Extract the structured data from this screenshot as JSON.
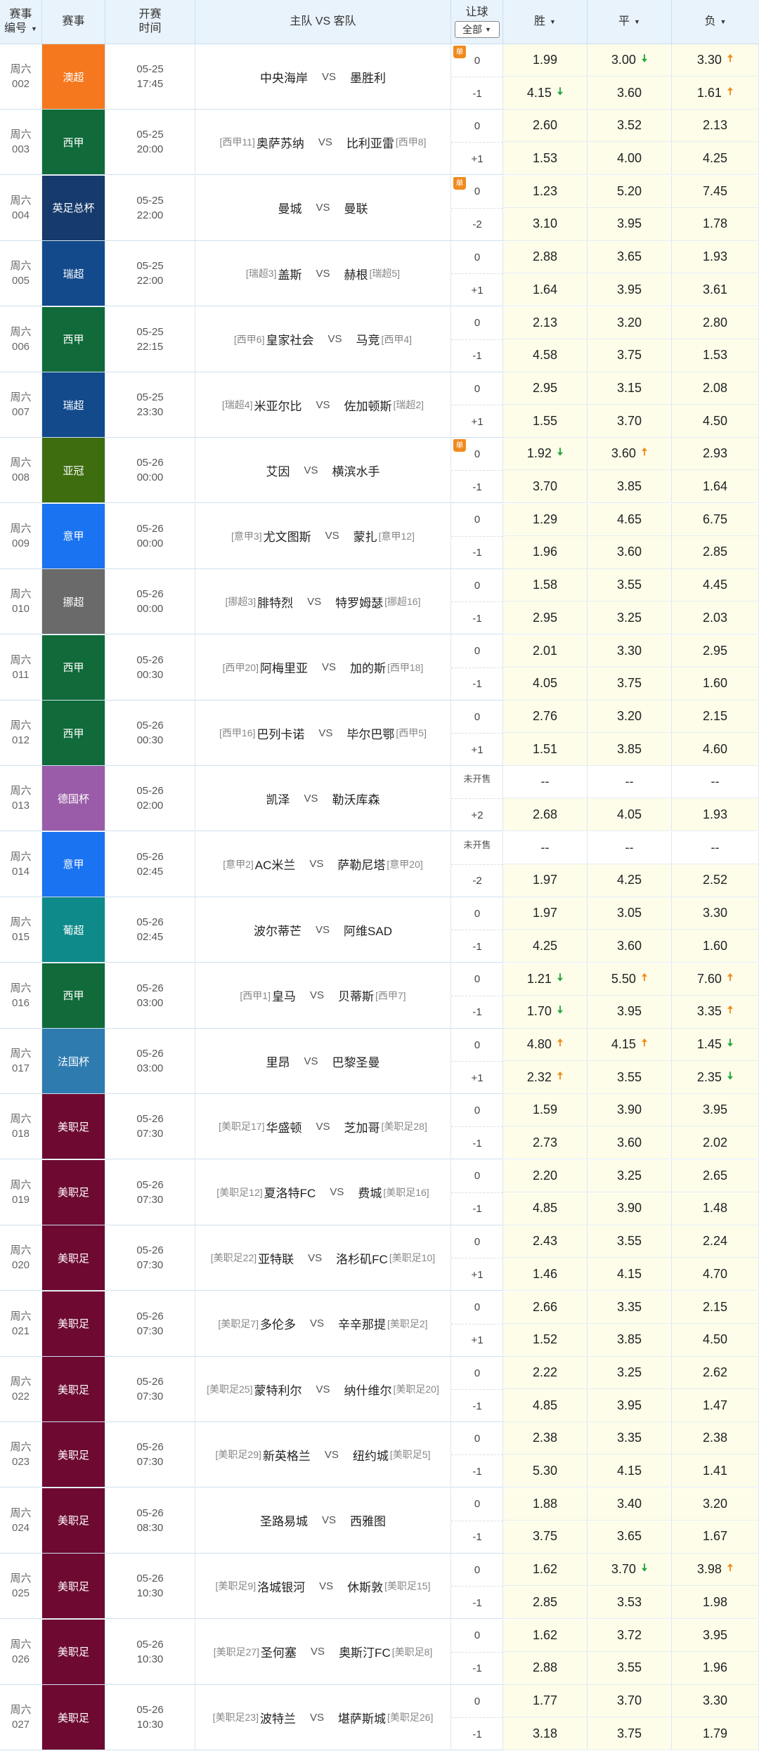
{
  "header": {
    "col_num": [
      "赛事",
      "编号"
    ],
    "col_league": "赛事",
    "col_time": [
      "开赛",
      "时间"
    ],
    "col_match": "主队 VS 客队",
    "col_handicap": "让球",
    "handicap_filter": "全部",
    "col_win": "胜",
    "col_draw": "平",
    "col_lose": "负"
  },
  "vs_label": "VS",
  "single_badge": "单",
  "arrow_up": "🠅",
  "arrow_down": "🠇",
  "matches": [
    {
      "day": "周六",
      "num": "002",
      "league": "澳超",
      "color": "#f5781e",
      "date": "05-25",
      "time": "17:45",
      "home_rank": "",
      "home": "中央海岸",
      "away": "墨胜利",
      "away_rank": "",
      "single": true,
      "hcp": [
        "0",
        "-1"
      ],
      "odds": [
        [
          [
            "1.99",
            ""
          ],
          [
            "3.00",
            "down"
          ],
          [
            "3.30",
            "up"
          ]
        ],
        [
          [
            "4.15",
            "down"
          ],
          [
            "3.60",
            ""
          ],
          [
            "1.61",
            "up"
          ]
        ]
      ]
    },
    {
      "day": "周六",
      "num": "003",
      "league": "西甲",
      "color": "#106a3a",
      "date": "05-25",
      "time": "20:00",
      "home_rank": "[西甲11]",
      "home": "奥萨苏纳",
      "away": "比利亚雷",
      "away_rank": "[西甲8]",
      "single": false,
      "hcp": [
        "0",
        "+1"
      ],
      "odds": [
        [
          [
            "2.60",
            ""
          ],
          [
            "3.52",
            ""
          ],
          [
            "2.13",
            ""
          ]
        ],
        [
          [
            "1.53",
            ""
          ],
          [
            "4.00",
            ""
          ],
          [
            "4.25",
            ""
          ]
        ]
      ]
    },
    {
      "day": "周六",
      "num": "004",
      "league": "英足总杯",
      "color": "#163a6c",
      "date": "05-25",
      "time": "22:00",
      "home_rank": "",
      "home": "曼城",
      "away": "曼联",
      "away_rank": "",
      "single": true,
      "hcp": [
        "0",
        "-2"
      ],
      "odds": [
        [
          [
            "1.23",
            ""
          ],
          [
            "5.20",
            ""
          ],
          [
            "7.45",
            ""
          ]
        ],
        [
          [
            "3.10",
            ""
          ],
          [
            "3.95",
            ""
          ],
          [
            "1.78",
            ""
          ]
        ]
      ]
    },
    {
      "day": "周六",
      "num": "005",
      "league": "瑞超",
      "color": "#124a8c",
      "date": "05-25",
      "time": "22:00",
      "home_rank": "[瑞超3]",
      "home": "盖斯",
      "away": "赫根",
      "away_rank": "[瑞超5]",
      "single": false,
      "hcp": [
        "0",
        "+1"
      ],
      "odds": [
        [
          [
            "2.88",
            ""
          ],
          [
            "3.65",
            ""
          ],
          [
            "1.93",
            ""
          ]
        ],
        [
          [
            "1.64",
            ""
          ],
          [
            "3.95",
            ""
          ],
          [
            "3.61",
            ""
          ]
        ]
      ]
    },
    {
      "day": "周六",
      "num": "006",
      "league": "西甲",
      "color": "#106a3a",
      "date": "05-25",
      "time": "22:15",
      "home_rank": "[西甲6]",
      "home": "皇家社会",
      "away": "马竞",
      "away_rank": "[西甲4]",
      "single": false,
      "hcp": [
        "0",
        "-1"
      ],
      "odds": [
        [
          [
            "2.13",
            ""
          ],
          [
            "3.20",
            ""
          ],
          [
            "2.80",
            ""
          ]
        ],
        [
          [
            "4.58",
            ""
          ],
          [
            "3.75",
            ""
          ],
          [
            "1.53",
            ""
          ]
        ]
      ]
    },
    {
      "day": "周六",
      "num": "007",
      "league": "瑞超",
      "color": "#124a8c",
      "date": "05-25",
      "time": "23:30",
      "home_rank": "[瑞超4]",
      "home": "米亚尔比",
      "away": "佐加顿斯",
      "away_rank": "[瑞超2]",
      "single": false,
      "hcp": [
        "0",
        "+1"
      ],
      "odds": [
        [
          [
            "2.95",
            ""
          ],
          [
            "3.15",
            ""
          ],
          [
            "2.08",
            ""
          ]
        ],
        [
          [
            "1.55",
            ""
          ],
          [
            "3.70",
            ""
          ],
          [
            "4.50",
            ""
          ]
        ]
      ]
    },
    {
      "day": "周六",
      "num": "008",
      "league": "亚冠",
      "color": "#3e6d10",
      "date": "05-26",
      "time": "00:00",
      "home_rank": "",
      "home": "艾因",
      "away": "横滨水手",
      "away_rank": "",
      "single": true,
      "hcp": [
        "0",
        "-1"
      ],
      "odds": [
        [
          [
            "1.92",
            "down"
          ],
          [
            "3.60",
            "up"
          ],
          [
            "2.93",
            ""
          ]
        ],
        [
          [
            "3.70",
            ""
          ],
          [
            "3.85",
            ""
          ],
          [
            "1.64",
            ""
          ]
        ]
      ]
    },
    {
      "day": "周六",
      "num": "009",
      "league": "意甲",
      "color": "#1a73f0",
      "date": "05-26",
      "time": "00:00",
      "home_rank": "[意甲3]",
      "home": "尤文图斯",
      "away": "蒙扎",
      "away_rank": "[意甲12]",
      "single": false,
      "hcp": [
        "0",
        "-1"
      ],
      "odds": [
        [
          [
            "1.29",
            ""
          ],
          [
            "4.65",
            ""
          ],
          [
            "6.75",
            ""
          ]
        ],
        [
          [
            "1.96",
            ""
          ],
          [
            "3.60",
            ""
          ],
          [
            "2.85",
            ""
          ]
        ]
      ]
    },
    {
      "day": "周六",
      "num": "010",
      "league": "挪超",
      "color": "#6a6a6a",
      "date": "05-26",
      "time": "00:00",
      "home_rank": "[挪超3]",
      "home": "腓特烈",
      "away": "特罗姆瑟",
      "away_rank": "[挪超16]",
      "single": false,
      "hcp": [
        "0",
        "-1"
      ],
      "odds": [
        [
          [
            "1.58",
            ""
          ],
          [
            "3.55",
            ""
          ],
          [
            "4.45",
            ""
          ]
        ],
        [
          [
            "2.95",
            ""
          ],
          [
            "3.25",
            ""
          ],
          [
            "2.03",
            ""
          ]
        ]
      ]
    },
    {
      "day": "周六",
      "num": "011",
      "league": "西甲",
      "color": "#106a3a",
      "date": "05-26",
      "time": "00:30",
      "home_rank": "[西甲20]",
      "home": "阿梅里亚",
      "away": "加的斯",
      "away_rank": "[西甲18]",
      "single": false,
      "hcp": [
        "0",
        "-1"
      ],
      "odds": [
        [
          [
            "2.01",
            ""
          ],
          [
            "3.30",
            ""
          ],
          [
            "2.95",
            ""
          ]
        ],
        [
          [
            "4.05",
            ""
          ],
          [
            "3.75",
            ""
          ],
          [
            "1.60",
            ""
          ]
        ]
      ]
    },
    {
      "day": "周六",
      "num": "012",
      "league": "西甲",
      "color": "#106a3a",
      "date": "05-26",
      "time": "00:30",
      "home_rank": "[西甲16]",
      "home": "巴列卡诺",
      "away": "毕尔巴鄂",
      "away_rank": "[西甲5]",
      "single": false,
      "hcp": [
        "0",
        "+1"
      ],
      "odds": [
        [
          [
            "2.76",
            ""
          ],
          [
            "3.20",
            ""
          ],
          [
            "2.15",
            ""
          ]
        ],
        [
          [
            "1.51",
            ""
          ],
          [
            "3.85",
            ""
          ],
          [
            "4.60",
            ""
          ]
        ]
      ]
    },
    {
      "day": "周六",
      "num": "013",
      "league": "德国杯",
      "color": "#9a5ca8",
      "date": "05-26",
      "time": "02:00",
      "home_rank": "",
      "home": "凯泽",
      "away": "勒沃库森",
      "away_rank": "",
      "single": false,
      "hcp": [
        "未开售",
        "+2"
      ],
      "odds": [
        [
          [
            "--",
            ""
          ],
          [
            "--",
            ""
          ],
          [
            "--",
            ""
          ]
        ],
        [
          [
            "2.68",
            ""
          ],
          [
            "4.05",
            ""
          ],
          [
            "1.93",
            ""
          ]
        ]
      ]
    },
    {
      "day": "周六",
      "num": "014",
      "league": "意甲",
      "color": "#1a73f0",
      "date": "05-26",
      "time": "02:45",
      "home_rank": "[意甲2]",
      "home": "AC米兰",
      "away": "萨勒尼塔",
      "away_rank": "[意甲20]",
      "single": false,
      "hcp": [
        "未开售",
        "-2"
      ],
      "odds": [
        [
          [
            "--",
            ""
          ],
          [
            "--",
            ""
          ],
          [
            "--",
            ""
          ]
        ],
        [
          [
            "1.97",
            ""
          ],
          [
            "4.25",
            ""
          ],
          [
            "2.52",
            ""
          ]
        ]
      ]
    },
    {
      "day": "周六",
      "num": "015",
      "league": "葡超",
      "color": "#0f8a8a",
      "date": "05-26",
      "time": "02:45",
      "home_rank": "",
      "home": "波尔蒂芒",
      "away": "阿维SAD",
      "away_rank": "",
      "single": false,
      "hcp": [
        "0",
        "-1"
      ],
      "odds": [
        [
          [
            "1.97",
            ""
          ],
          [
            "3.05",
            ""
          ],
          [
            "3.30",
            ""
          ]
        ],
        [
          [
            "4.25",
            ""
          ],
          [
            "3.60",
            ""
          ],
          [
            "1.60",
            ""
          ]
        ]
      ]
    },
    {
      "day": "周六",
      "num": "016",
      "league": "西甲",
      "color": "#106a3a",
      "date": "05-26",
      "time": "03:00",
      "home_rank": "[西甲1]",
      "home": "皇马",
      "away": "贝蒂斯",
      "away_rank": "[西甲7]",
      "single": false,
      "hcp": [
        "0",
        "-1"
      ],
      "odds": [
        [
          [
            "1.21",
            "down"
          ],
          [
            "5.50",
            "up"
          ],
          [
            "7.60",
            "up"
          ]
        ],
        [
          [
            "1.70",
            "down"
          ],
          [
            "3.95",
            ""
          ],
          [
            "3.35",
            "up"
          ]
        ]
      ]
    },
    {
      "day": "周六",
      "num": "017",
      "league": "法国杯",
      "color": "#2e7bb0",
      "date": "05-26",
      "time": "03:00",
      "home_rank": "",
      "home": "里昂",
      "away": "巴黎圣曼",
      "away_rank": "",
      "single": false,
      "hcp": [
        "0",
        "+1"
      ],
      "odds": [
        [
          [
            "4.80",
            "up"
          ],
          [
            "4.15",
            "up"
          ],
          [
            "1.45",
            "down"
          ]
        ],
        [
          [
            "2.32",
            "up"
          ],
          [
            "3.55",
            ""
          ],
          [
            "2.35",
            "down"
          ]
        ]
      ]
    },
    {
      "day": "周六",
      "num": "018",
      "league": "美职足",
      "color": "#6e0a32",
      "date": "05-26",
      "time": "07:30",
      "home_rank": "[美职足17]",
      "home": "华盛顿",
      "away": "芝加哥",
      "away_rank": "[美职足28]",
      "single": false,
      "hcp": [
        "0",
        "-1"
      ],
      "odds": [
        [
          [
            "1.59",
            ""
          ],
          [
            "3.90",
            ""
          ],
          [
            "3.95",
            ""
          ]
        ],
        [
          [
            "2.73",
            ""
          ],
          [
            "3.60",
            ""
          ],
          [
            "2.02",
            ""
          ]
        ]
      ]
    },
    {
      "day": "周六",
      "num": "019",
      "league": "美职足",
      "color": "#6e0a32",
      "date": "05-26",
      "time": "07:30",
      "home_rank": "[美职足12]",
      "home": "夏洛特FC",
      "away": "费城",
      "away_rank": "[美职足16]",
      "single": false,
      "hcp": [
        "0",
        "-1"
      ],
      "odds": [
        [
          [
            "2.20",
            ""
          ],
          [
            "3.25",
            ""
          ],
          [
            "2.65",
            ""
          ]
        ],
        [
          [
            "4.85",
            ""
          ],
          [
            "3.90",
            ""
          ],
          [
            "1.48",
            ""
          ]
        ]
      ]
    },
    {
      "day": "周六",
      "num": "020",
      "league": "美职足",
      "color": "#6e0a32",
      "date": "05-26",
      "time": "07:30",
      "home_rank": "[美职足22]",
      "home": "亚特联",
      "away": "洛杉矶FC",
      "away_rank": "[美职足10]",
      "single": false,
      "hcp": [
        "0",
        "+1"
      ],
      "odds": [
        [
          [
            "2.43",
            ""
          ],
          [
            "3.55",
            ""
          ],
          [
            "2.24",
            ""
          ]
        ],
        [
          [
            "1.46",
            ""
          ],
          [
            "4.15",
            ""
          ],
          [
            "4.70",
            ""
          ]
        ]
      ]
    },
    {
      "day": "周六",
      "num": "021",
      "league": "美职足",
      "color": "#6e0a32",
      "date": "05-26",
      "time": "07:30",
      "home_rank": "[美职足7]",
      "home": "多伦多",
      "away": "辛辛那提",
      "away_rank": "[美职足2]",
      "single": false,
      "hcp": [
        "0",
        "+1"
      ],
      "odds": [
        [
          [
            "2.66",
            ""
          ],
          [
            "3.35",
            ""
          ],
          [
            "2.15",
            ""
          ]
        ],
        [
          [
            "1.52",
            ""
          ],
          [
            "3.85",
            ""
          ],
          [
            "4.50",
            ""
          ]
        ]
      ]
    },
    {
      "day": "周六",
      "num": "022",
      "league": "美职足",
      "color": "#6e0a32",
      "date": "05-26",
      "time": "07:30",
      "home_rank": "[美职足25]",
      "home": "蒙特利尔",
      "away": "纳什维尔",
      "away_rank": "[美职足20]",
      "single": false,
      "hcp": [
        "0",
        "-1"
      ],
      "odds": [
        [
          [
            "2.22",
            ""
          ],
          [
            "3.25",
            ""
          ],
          [
            "2.62",
            ""
          ]
        ],
        [
          [
            "4.85",
            ""
          ],
          [
            "3.95",
            ""
          ],
          [
            "1.47",
            ""
          ]
        ]
      ]
    },
    {
      "day": "周六",
      "num": "023",
      "league": "美职足",
      "color": "#6e0a32",
      "date": "05-26",
      "time": "07:30",
      "home_rank": "[美职足29]",
      "home": "新英格兰",
      "away": "纽约城",
      "away_rank": "[美职足5]",
      "single": false,
      "hcp": [
        "0",
        "-1"
      ],
      "odds": [
        [
          [
            "2.38",
            ""
          ],
          [
            "3.35",
            ""
          ],
          [
            "2.38",
            ""
          ]
        ],
        [
          [
            "5.30",
            ""
          ],
          [
            "4.15",
            ""
          ],
          [
            "1.41",
            ""
          ]
        ]
      ]
    },
    {
      "day": "周六",
      "num": "024",
      "league": "美职足",
      "color": "#6e0a32",
      "date": "05-26",
      "time": "08:30",
      "home_rank": "",
      "home": "圣路易城",
      "away": "西雅图",
      "away_rank": "",
      "single": false,
      "hcp": [
        "0",
        "-1"
      ],
      "odds": [
        [
          [
            "1.88",
            ""
          ],
          [
            "3.40",
            ""
          ],
          [
            "3.20",
            ""
          ]
        ],
        [
          [
            "3.75",
            ""
          ],
          [
            "3.65",
            ""
          ],
          [
            "1.67",
            ""
          ]
        ]
      ]
    },
    {
      "day": "周六",
      "num": "025",
      "league": "美职足",
      "color": "#6e0a32",
      "date": "05-26",
      "time": "10:30",
      "home_rank": "[美职足9]",
      "home": "洛城银河",
      "away": "休斯敦",
      "away_rank": "[美职足15]",
      "single": false,
      "hcp": [
        "0",
        "-1"
      ],
      "odds": [
        [
          [
            "1.62",
            ""
          ],
          [
            "3.70",
            "down"
          ],
          [
            "3.98",
            "up"
          ]
        ],
        [
          [
            "2.85",
            ""
          ],
          [
            "3.53",
            ""
          ],
          [
            "1.98",
            ""
          ]
        ]
      ]
    },
    {
      "day": "周六",
      "num": "026",
      "league": "美职足",
      "color": "#6e0a32",
      "date": "05-26",
      "time": "10:30",
      "home_rank": "[美职足27]",
      "home": "圣何塞",
      "away": "奥斯汀FC",
      "away_rank": "[美职足8]",
      "single": false,
      "hcp": [
        "0",
        "-1"
      ],
      "odds": [
        [
          [
            "1.62",
            ""
          ],
          [
            "3.72",
            ""
          ],
          [
            "3.95",
            ""
          ]
        ],
        [
          [
            "2.88",
            ""
          ],
          [
            "3.55",
            ""
          ],
          [
            "1.96",
            ""
          ]
        ]
      ]
    },
    {
      "day": "周六",
      "num": "027",
      "league": "美职足",
      "color": "#6e0a32",
      "date": "05-26",
      "time": "10:30",
      "home_rank": "[美职足23]",
      "home": "波特兰",
      "away": "堪萨斯城",
      "away_rank": "[美职足26]",
      "single": false,
      "hcp": [
        "0",
        "-1"
      ],
      "odds": [
        [
          [
            "1.77",
            ""
          ],
          [
            "3.70",
            ""
          ],
          [
            "3.30",
            ""
          ]
        ],
        [
          [
            "3.18",
            ""
          ],
          [
            "3.75",
            ""
          ],
          [
            "1.79",
            ""
          ]
        ]
      ]
    }
  ]
}
